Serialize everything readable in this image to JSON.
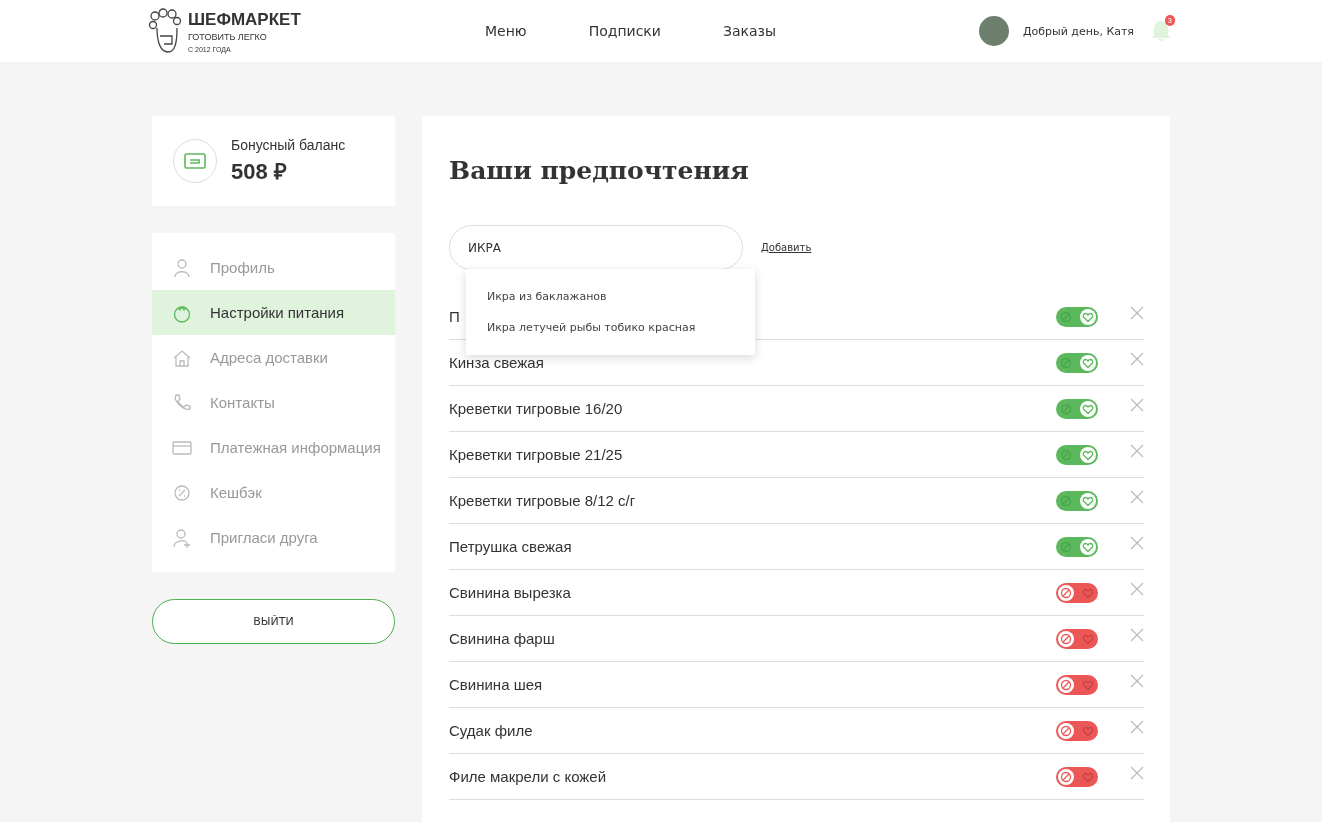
{
  "header": {
    "logo": {
      "name": "ШЕФМАРКЕТ",
      "tagline": "ГОТОВИТЬ ЛЕГКО",
      "since": "С 2012 ГОДА"
    },
    "nav": [
      {
        "label": "Меню"
      },
      {
        "label": "Подписки"
      },
      {
        "label": "Заказы"
      }
    ],
    "greeting": "Добрый день, Катя",
    "notifications": "3"
  },
  "bonus": {
    "label": "Бонусный баланс",
    "amount": "508 ₽"
  },
  "sidebar": {
    "items": [
      {
        "label": "Профиль",
        "selected": false
      },
      {
        "label": "Настройки питания",
        "selected": true
      },
      {
        "label": "Адреса доставки",
        "selected": false
      },
      {
        "label": "Контакты",
        "selected": false
      },
      {
        "label": "Платежная информация",
        "selected": false
      },
      {
        "label": "Кешбэк",
        "selected": false
      },
      {
        "label": "Пригласи друга",
        "selected": false
      }
    ],
    "logout": "ВЫЙТИ"
  },
  "preferences": {
    "title": "Ваши предпочтения",
    "search": {
      "value": "ИКРА"
    },
    "add_link": "Добавить",
    "suggestions": [
      "Икра из баклажанов",
      "Икра летучей рыбы тобико красная"
    ],
    "items": [
      {
        "name": "П",
        "liked": true
      },
      {
        "name": "Кинза свежая",
        "liked": true
      },
      {
        "name": "Креветки тигровые 16/20",
        "liked": true
      },
      {
        "name": "Креветки тигровые 21/25",
        "liked": true
      },
      {
        "name": "Креветки тигровые 8/12 с/г",
        "liked": true
      },
      {
        "name": "Петрушка свежая",
        "liked": true
      },
      {
        "name": "Свинина вырезка",
        "liked": false
      },
      {
        "name": "Свинина фарш",
        "liked": false
      },
      {
        "name": "Свинина шея",
        "liked": false
      },
      {
        "name": "Судак филе",
        "liked": false
      },
      {
        "name": "Филе макрели с кожей",
        "liked": false
      }
    ]
  }
}
